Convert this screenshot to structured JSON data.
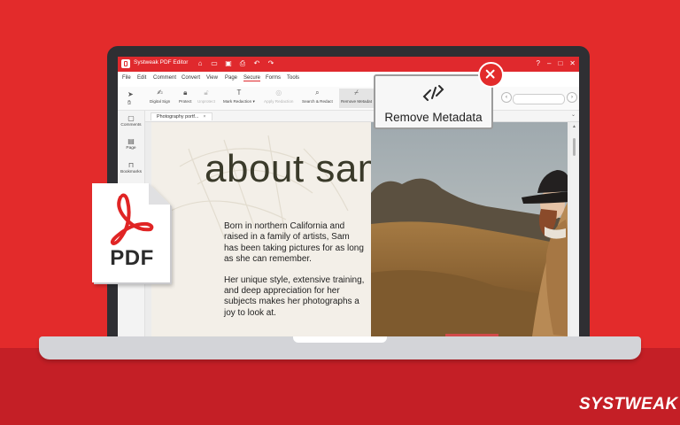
{
  "colors": {
    "background_red": "#e32b2b",
    "band_red": "#c41f26",
    "title_bar_red": "#e0292d",
    "page_cream": "#f3efe8",
    "title_text": "#3a3a2a"
  },
  "app": {
    "title": "Systweak PDF Editor",
    "logo_icon": "app-logo-icon",
    "quick_icons": [
      "home-icon",
      "folder-icon",
      "save-icon",
      "print-icon",
      "undo-icon",
      "redo-icon"
    ],
    "window_icons": [
      "help-icon",
      "minimize-icon",
      "maximize-icon",
      "close-icon"
    ]
  },
  "menu": {
    "items": [
      "File",
      "Edit",
      "Comment",
      "Convert",
      "View",
      "Page",
      "Secure",
      "Forms",
      "Tools"
    ],
    "active": "Secure"
  },
  "toolbar": {
    "digital_sign": "Digital Sign",
    "protect": "Protect",
    "unprotect": "Unprotect",
    "mark_redaction": "Mark Redaction",
    "apply_redaction": "Apply Redaction",
    "search_redact": "Search & Redact",
    "remove_metadata": "Remove Metadat"
  },
  "sidebar": {
    "comments": "Comments",
    "page": "Page",
    "bookmarks": "Bookmarks"
  },
  "tab": {
    "label": "Photography portf...",
    "close": "×"
  },
  "document": {
    "title": "about sam",
    "paragraph_1": "Born in northern California and raised in a family of artists, Sam has been taking pictures for as long as she can remember.",
    "paragraph_2": "Her unique style, extensive training, and deep appreciation for her subjects makes her photographs a joy to look at."
  },
  "callout": {
    "label": "Remove Metadata",
    "icon": "unlink-icon"
  },
  "pdf_badge": {
    "label": "PDF",
    "icon": "acrobat-icon"
  },
  "brand": {
    "name": "SYSTWEAK"
  }
}
